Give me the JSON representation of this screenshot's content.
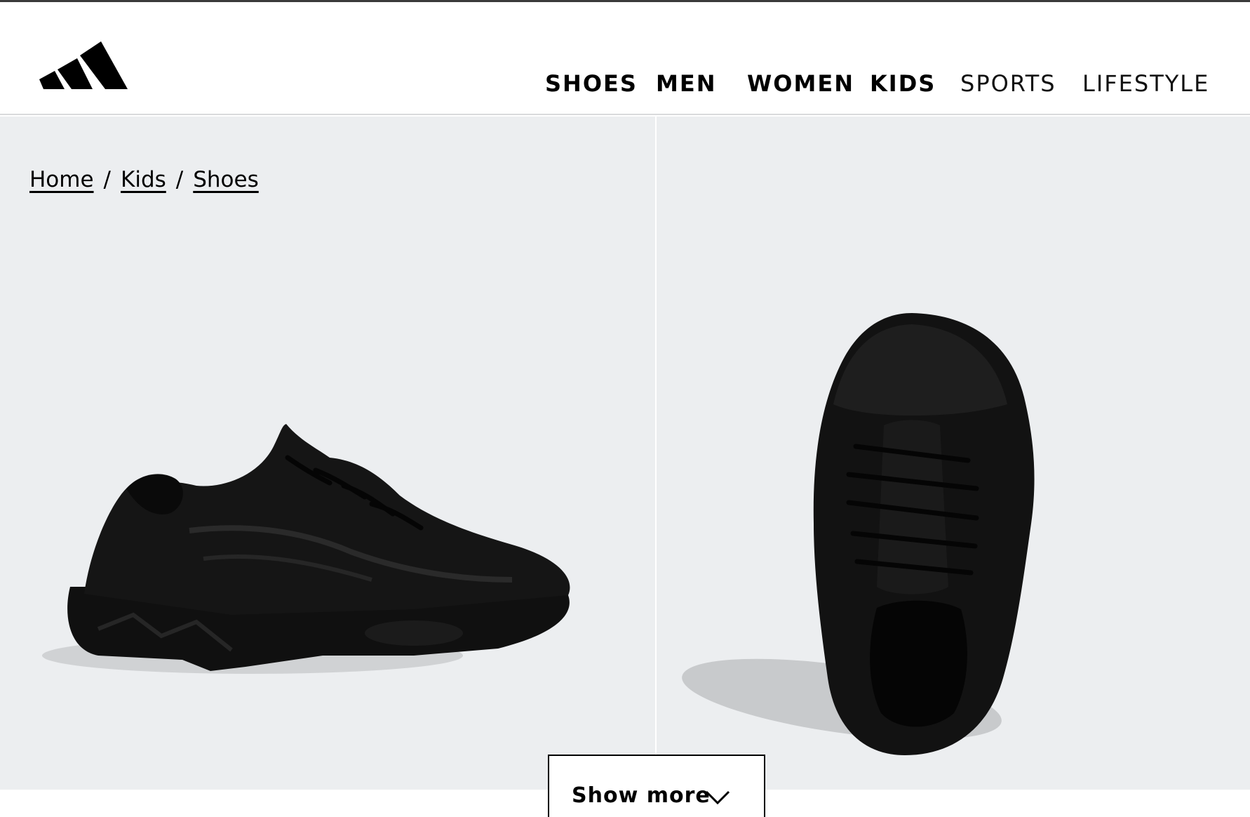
{
  "brand": {
    "logo_icon": "adidas-three-stripes-logo"
  },
  "nav": {
    "items": [
      {
        "label": "SHOES",
        "style": "bold"
      },
      {
        "label": "MEN",
        "style": "bold"
      },
      {
        "label": "WOMEN",
        "style": "bold"
      },
      {
        "label": "KIDS",
        "style": "bold"
      },
      {
        "label": "SPORTS",
        "style": "light"
      },
      {
        "label": "LIFESTYLE",
        "style": "light"
      }
    ]
  },
  "breadcrumb": {
    "items": [
      {
        "label": "Home"
      },
      {
        "label": "Kids"
      },
      {
        "label": "Shoes"
      }
    ],
    "separator": "/"
  },
  "gallery": {
    "images": [
      {
        "name": "product-image-side",
        "icon": "black-sneaker-side-view"
      },
      {
        "name": "product-image-top",
        "icon": "black-sneaker-top-view"
      }
    ],
    "background": "#eceef0"
  },
  "show_more": {
    "label": "Show more",
    "icon": "chevron-down-icon"
  },
  "colors": {
    "accent": "#000000",
    "gallery_bg": "#eceef0",
    "divider": "#d9dadc"
  }
}
